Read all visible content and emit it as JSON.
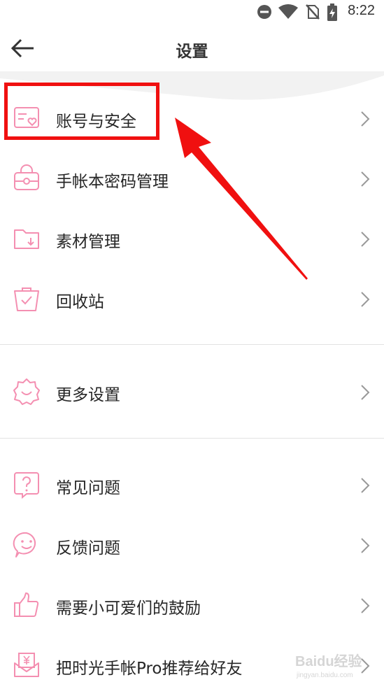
{
  "status_bar": {
    "time": "8:22",
    "icons": [
      "do-not-disturb-icon",
      "wifi-icon",
      "no-sim-icon",
      "battery-charging-icon"
    ]
  },
  "header": {
    "title": "设置",
    "back_icon": "back-arrow-icon"
  },
  "accent_color": "#f48fb1",
  "highlight_color": "#f01010",
  "sections": [
    {
      "items": [
        {
          "label": "账号与安全",
          "icon": "account-card-icon"
        },
        {
          "label": "手帐本密码管理",
          "icon": "lock-bag-icon"
        },
        {
          "label": "素材管理",
          "icon": "folder-download-icon"
        },
        {
          "label": "回收站",
          "icon": "trash-bag-icon"
        }
      ]
    },
    {
      "items": [
        {
          "label": "更多设置",
          "icon": "gear-icon"
        }
      ]
    },
    {
      "items": [
        {
          "label": "常见问题",
          "icon": "question-bubble-icon"
        },
        {
          "label": "反馈问题",
          "icon": "smile-bubble-icon"
        },
        {
          "label": "需要小可爱们的鼓励",
          "icon": "thumbs-up-icon"
        },
        {
          "label": "把时光手帐Pro推荐给好友",
          "icon": "gift-yen-icon"
        }
      ]
    }
  ],
  "watermark": {
    "brand": "Baidu经验",
    "url": "jingyan.baidu.com"
  }
}
